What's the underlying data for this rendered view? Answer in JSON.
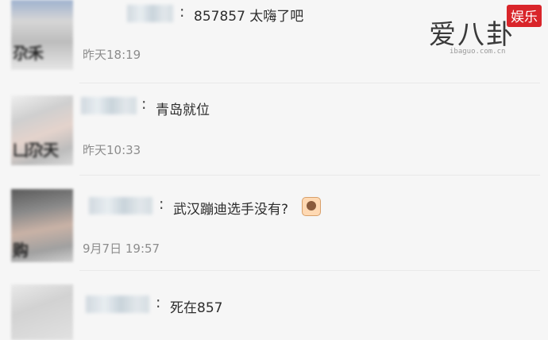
{
  "comments": [
    {
      "avatar_text": "尕禾",
      "message": "857857 太嗨了吧",
      "time": "昨天18:19",
      "has_emoji": false
    },
    {
      "avatar_text": "凵尕天",
      "message": "青岛就位",
      "time": "昨天10:33",
      "has_emoji": false
    },
    {
      "avatar_text": "购",
      "message": "武汉蹦迪选手没有?",
      "time": "9月7日 19:57",
      "has_emoji": true,
      "emoji_icon": "person-raising-hand-emoji-icon"
    },
    {
      "avatar_text": "",
      "message": "死在857",
      "time": "",
      "has_emoji": false
    }
  ],
  "watermark": {
    "main": "爱八卦",
    "badge": "娱乐",
    "url": "ibaguo.com.cn"
  },
  "colors": {
    "background": "#f6f6f6",
    "time_text": "#8d8d8d",
    "badge": "#d9252a"
  }
}
